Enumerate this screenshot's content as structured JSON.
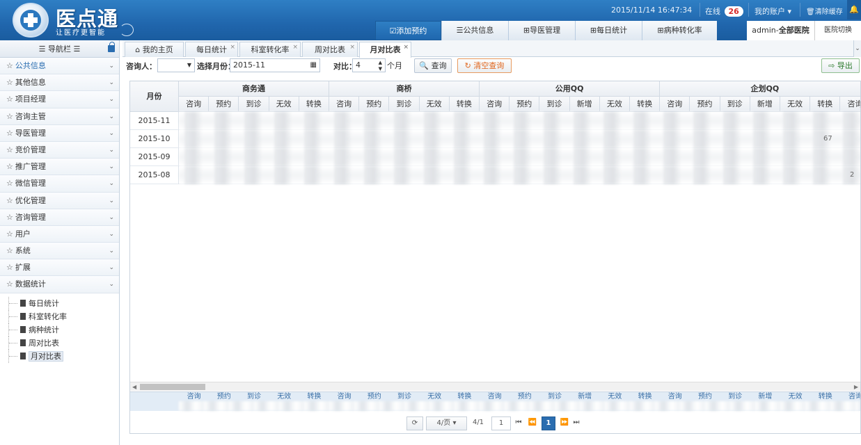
{
  "header": {
    "brand": "医点通",
    "slogan": "让医疗更智能",
    "datetime": "2015/11/14 16:47:34",
    "online_label": "在线",
    "online_count": "26",
    "account_label": "我的账户 ▾",
    "clear_cache_label": "清除缓存",
    "nav": [
      {
        "label": "☑添加预约"
      },
      {
        "label": "公共信息"
      },
      {
        "label": "导医管理"
      },
      {
        "label": "每日统计"
      },
      {
        "label": "病种转化率"
      }
    ],
    "user_prefix": "admin-",
    "user_scope": "全部医院",
    "hospital_switch": "医院切换"
  },
  "sidebar": {
    "title": "☰ 导航栏 ☰",
    "items": [
      {
        "label": "公共信息"
      },
      {
        "label": "其他信息"
      },
      {
        "label": "项目经理"
      },
      {
        "label": "咨询主管"
      },
      {
        "label": "导医管理"
      },
      {
        "label": "竞价管理"
      },
      {
        "label": "推广管理"
      },
      {
        "label": "微信管理"
      },
      {
        "label": "优化管理"
      },
      {
        "label": "咨询管理"
      },
      {
        "label": "用户"
      },
      {
        "label": "系统"
      },
      {
        "label": "扩展"
      },
      {
        "label": "数据统计"
      }
    ],
    "subitems": [
      {
        "label": "每日统计"
      },
      {
        "label": "科室转化率"
      },
      {
        "label": "病种统计"
      },
      {
        "label": "周对比表"
      },
      {
        "label": "月对比表"
      }
    ]
  },
  "tabs": [
    {
      "label": "我的主页"
    },
    {
      "label": "每日统计"
    },
    {
      "label": "科室转化率"
    },
    {
      "label": "周对比表"
    },
    {
      "label": "月对比表"
    }
  ],
  "toolbar": {
    "consultant_label": "咨询人：",
    "consultant_value": "",
    "month_label": "选择月份：",
    "month_value": "2015-11",
    "compare_label": "对比：",
    "compare_value": "4",
    "compare_unit": "个月",
    "query_label": "查询",
    "clear_query_label": "清空查询",
    "export_label": "导出"
  },
  "grid": {
    "month_header": "月份",
    "groups": [
      {
        "label": "商务通",
        "cols": [
          "咨询",
          "预约",
          "到诊",
          "无效",
          "转换"
        ]
      },
      {
        "label": "商桥",
        "cols": [
          "咨询",
          "预约",
          "到诊",
          "无效",
          "转换"
        ]
      },
      {
        "label": "公用QQ",
        "cols": [
          "咨询",
          "预约",
          "到诊",
          "新增",
          "无效",
          "转换"
        ]
      },
      {
        "label": "企划QQ",
        "cols": [
          "咨询",
          "预约",
          "到诊",
          "新增",
          "无效",
          "转换",
          "咨询"
        ]
      }
    ],
    "rows": [
      {
        "month": "2015-11"
      },
      {
        "month": "2015-10",
        "fragment": "67"
      },
      {
        "month": "2015-09"
      },
      {
        "month": "2015-08",
        "fragment": "2"
      }
    ],
    "footer_cols": [
      "咨询",
      "预约",
      "到诊",
      "无效",
      "转换",
      "咨询",
      "预约",
      "到诊",
      "无效",
      "转换",
      "咨询",
      "预约",
      "到诊",
      "新增",
      "无效",
      "转换",
      "咨询",
      "预约",
      "到诊",
      "新增",
      "无效",
      "转换",
      "咨询"
    ]
  },
  "pager": {
    "page_size": "4/页",
    "page_info": "4/1",
    "page_input": "1",
    "current_page": "1"
  }
}
